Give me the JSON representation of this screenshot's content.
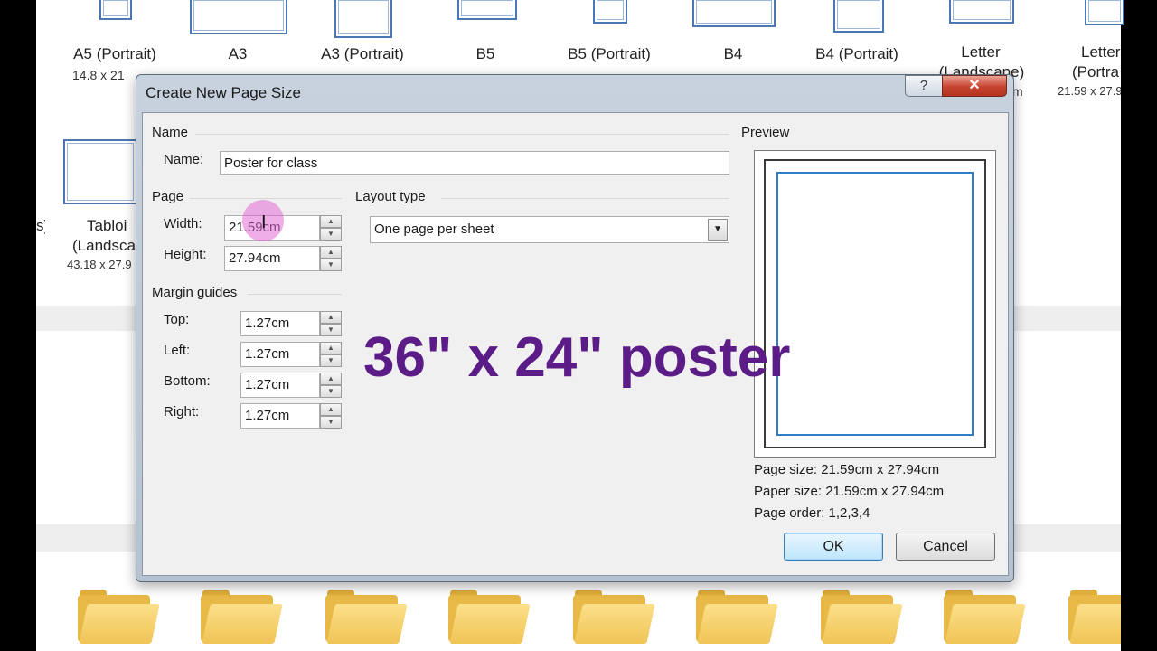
{
  "background": {
    "templates_top": [
      {
        "name": "A5 (Portrait)",
        "size": "14.8 x 21"
      },
      {
        "name": "A3",
        "size": ""
      },
      {
        "name": "A3 (Portrait)",
        "size": ""
      },
      {
        "name": "B5",
        "size": ""
      },
      {
        "name": "B5 (Portrait)",
        "size": ""
      },
      {
        "name": "B4",
        "size": ""
      },
      {
        "name": "B4 (Portrait)",
        "size": ""
      },
      {
        "name": "Letter",
        "size": "(Landscape)"
      },
      {
        "name": "Letter",
        "size": "(Portra",
        "size2": "21.59 x 27.9"
      }
    ],
    "left_cut_label": "s)",
    "tabloid": {
      "name": "Tabloi",
      "sub": "(Landsca",
      "size": "43.18 x 27.9"
    },
    "right_cut": "m"
  },
  "dialog": {
    "title": "Create New Page Size",
    "help_label": "?",
    "close_label": "✕",
    "name_section": "Name",
    "name_label": "Name:",
    "name_value": "Poster for class",
    "page_section": "Page",
    "width_label": "Width:",
    "width_value": "21.59cm",
    "height_label": "Height:",
    "height_value": "27.94cm",
    "layout_section": "Layout type",
    "layout_value": "One page per sheet",
    "margin_section": "Margin guides",
    "top_label": "Top:",
    "top_value": "1.27cm",
    "left_label": "Left:",
    "left_value": "1.27cm",
    "bottom_label": "Bottom:",
    "bottom_value": "1.27cm",
    "right_label": "Right:",
    "right_value": "1.27cm",
    "preview_section": "Preview",
    "page_size_info": "Page size: 21.59cm x 27.94cm",
    "paper_size_info": "Paper size: 21.59cm x 27.94cm",
    "page_order_info": "Page order: 1,2,3,4",
    "ok_label": "OK",
    "cancel_label": "Cancel"
  },
  "overlay": {
    "caption": "36\" x 24\" poster"
  },
  "colors": {
    "caption": "#5b1c87",
    "highlight": "#e26cd4",
    "close_button": "#c7432e",
    "thumbnail_border": "#4a78b5"
  }
}
